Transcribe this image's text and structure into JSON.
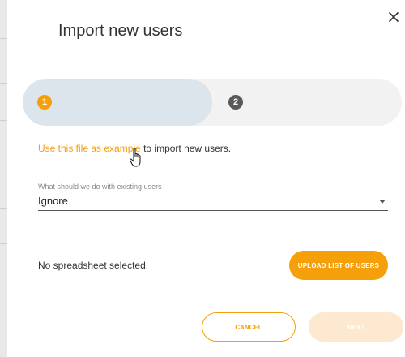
{
  "dialog": {
    "title": "Import new users",
    "close_icon": "close-icon"
  },
  "stepper": {
    "steps": [
      {
        "number": "1",
        "state": "active"
      },
      {
        "number": "2",
        "state": "inactive"
      }
    ]
  },
  "instruction": {
    "link_text": "Use this file as example ",
    "rest_text": "to import new users."
  },
  "existing_users": {
    "label": "What should we do with existing users",
    "value": "Ignore"
  },
  "upload": {
    "status": "No spreadsheet selected.",
    "button_label": "UPLOAD LIST OF USERS"
  },
  "footer": {
    "cancel_label": "CANCEL",
    "next_label": "NEXT"
  },
  "colors": {
    "accent": "#f59f0a",
    "accent_disabled": "#fde9cf",
    "step_active_bg": "#dde5ec",
    "step_inactive_bg": "#f2f2f2"
  }
}
